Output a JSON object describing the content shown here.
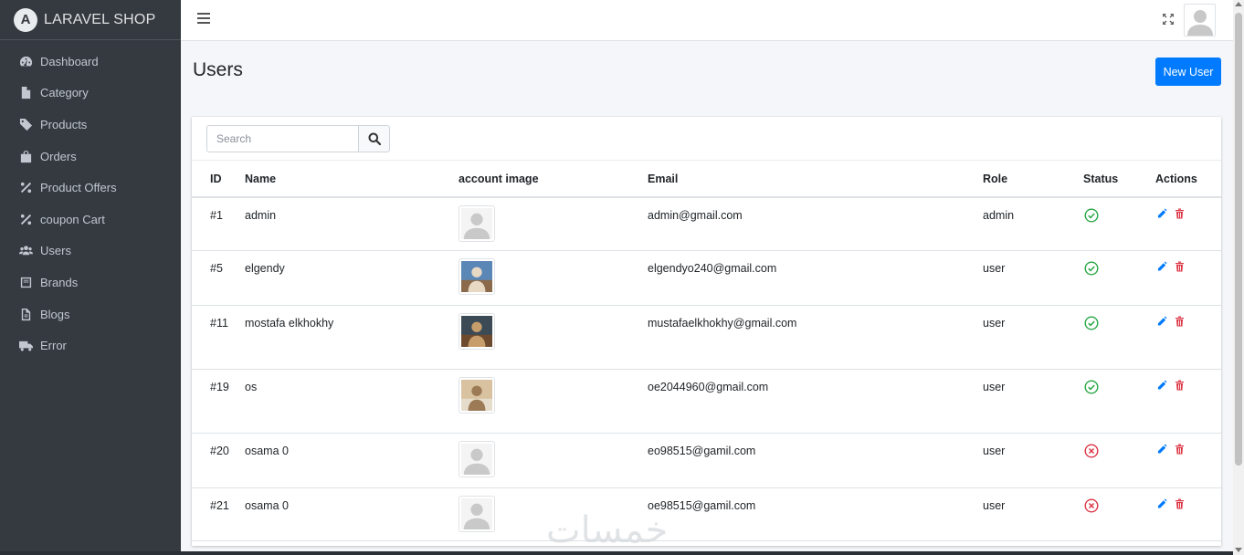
{
  "brand": {
    "name": "LARAVEL SHOP",
    "logo_letter": "A"
  },
  "sidebar": {
    "items": [
      {
        "label": "Dashboard",
        "icon": "tachometer-icon"
      },
      {
        "label": "Category",
        "icon": "file-icon"
      },
      {
        "label": "Products",
        "icon": "tag-icon"
      },
      {
        "label": "Orders",
        "icon": "shopping-bag-icon"
      },
      {
        "label": "Product Offers",
        "icon": "percent-icon"
      },
      {
        "label": "coupon Cart",
        "icon": "percent-icon"
      },
      {
        "label": "Users",
        "icon": "users-icon"
      },
      {
        "label": "Brands",
        "icon": "book-icon"
      },
      {
        "label": "Blogs",
        "icon": "file-text-icon"
      },
      {
        "label": "Error",
        "icon": "truck-icon"
      }
    ]
  },
  "page": {
    "title": "Users",
    "new_button": "New User"
  },
  "search": {
    "placeholder": "Search"
  },
  "table": {
    "columns": [
      "ID",
      "Name",
      "account image",
      "Email",
      "Role",
      "Status",
      "Actions"
    ],
    "rows": [
      {
        "id": "#1",
        "name": "admin",
        "image": "default-avatar",
        "email": "admin@gmail.com",
        "role": "admin",
        "status": "active"
      },
      {
        "id": "#5",
        "name": "elgendy",
        "image": "photo",
        "email": "elgendyo240@gmail.com",
        "role": "user",
        "status": "active"
      },
      {
        "id": "#11",
        "name": "mostafa elkhokhy",
        "image": "photo",
        "email": "mustafaelkhokhy@gmail.com",
        "role": "user",
        "status": "active"
      },
      {
        "id": "#19",
        "name": "os",
        "image": "photo",
        "email": "oe2044960@gmail.com",
        "role": "user",
        "status": "active"
      },
      {
        "id": "#20",
        "name": "osama 0",
        "image": "default-avatar",
        "email": "eo98515@gamil.com",
        "role": "user",
        "status": "inactive"
      },
      {
        "id": "#21",
        "name": "osama 0",
        "image": "default-avatar",
        "email": "oe98515@gamil.com",
        "role": "user",
        "status": "inactive"
      }
    ]
  },
  "watermark": "خمسات",
  "colors": {
    "sidebar": "#343a40",
    "primary": "#007bff",
    "success": "#28a745",
    "danger": "#dc3545"
  }
}
